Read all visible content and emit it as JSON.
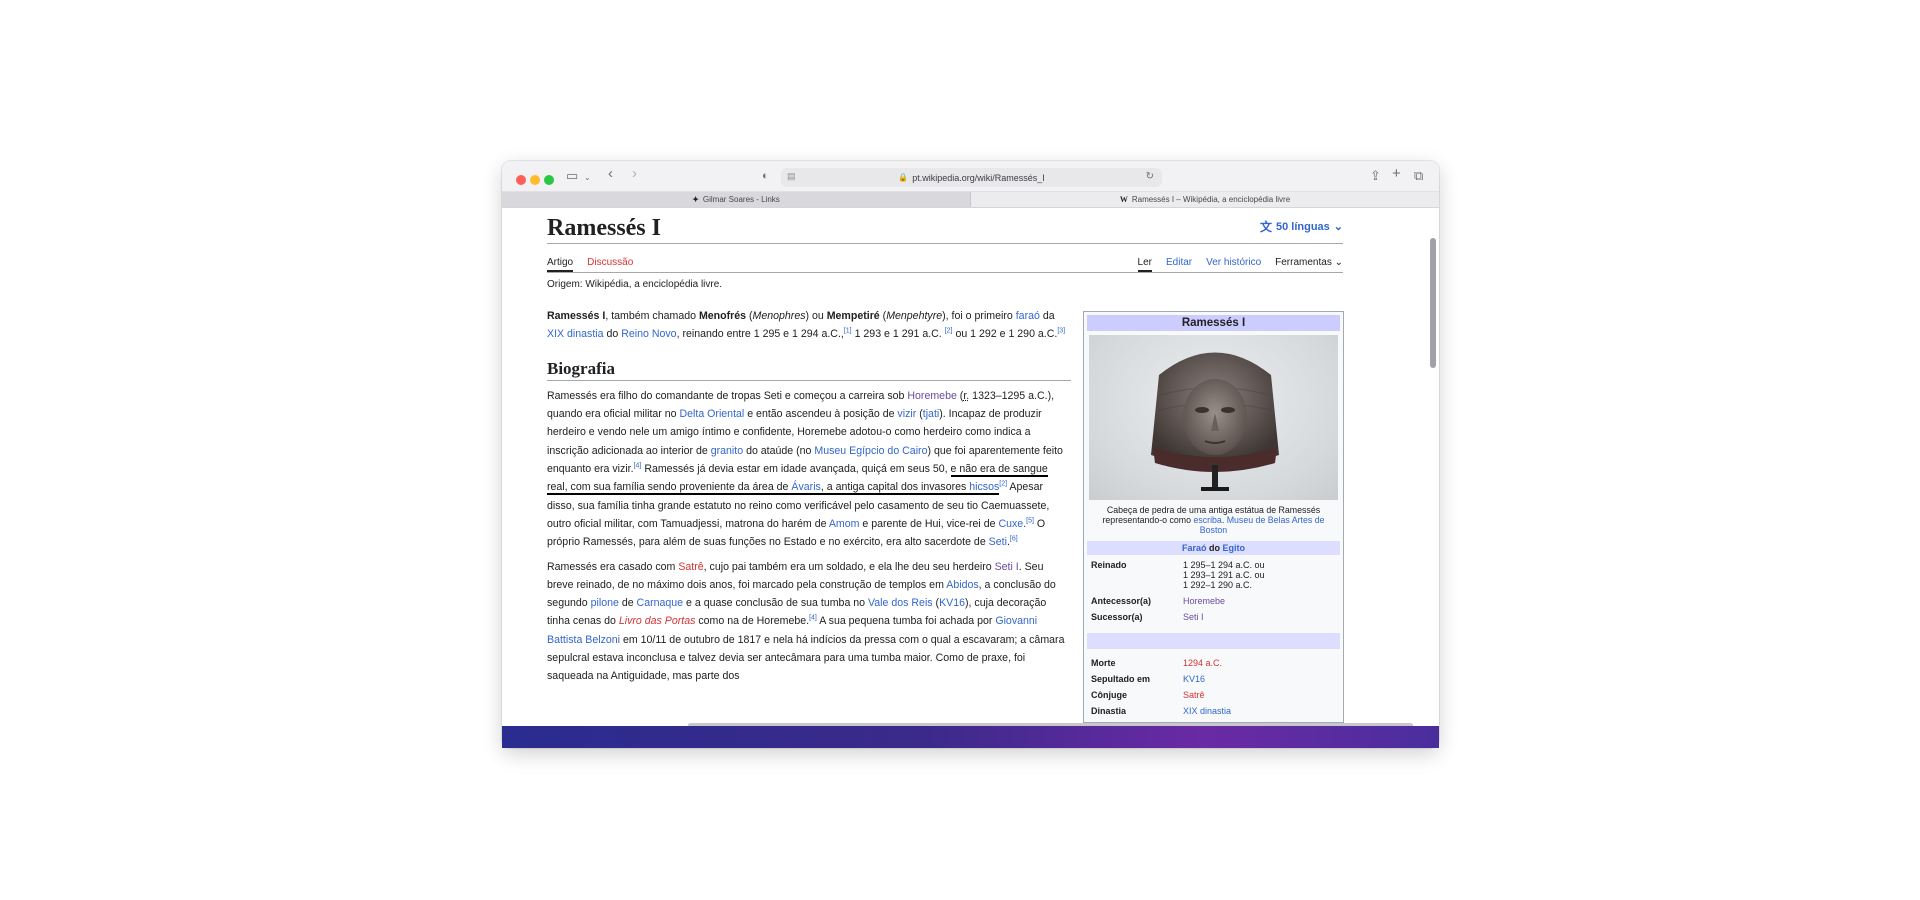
{
  "browser": {
    "url": "pt.wikipedia.org/wiki/Ramessés_I",
    "tabs": [
      {
        "label": "Gilmar Soares - Links"
      },
      {
        "label": "Ramessés I – Wikipédia, a enciclopédia livre"
      }
    ]
  },
  "article": {
    "title": "Ramessés I",
    "languages": "50 línguas",
    "tabs": {
      "article": "Artigo",
      "discussion": "Discussão",
      "read": "Ler",
      "edit": "Editar",
      "history": "Ver histórico",
      "tools": "Ferramentas"
    },
    "origin": "Origem: Wikipédia, a enciclopédia livre.",
    "section": "Biografia",
    "intro": {
      "name": "Ramessés I",
      "t1": ", também chamado ",
      "alt1": "Menofrés",
      "t2": " (",
      "alt1_greek": "Menophres",
      "t3": ") ou ",
      "alt2": "Mempetiré",
      "t4": " (",
      "alt2_orig": "Menpehtyre",
      "t5": "), foi o primeiro ",
      "l_farao": "faraó",
      "t6": " da ",
      "l_dinastia": "XIX dinastia",
      "t7": " do ",
      "l_reino": "Reino Novo",
      "t8": ", reinando entre 1 295 e 1 294 a.C.,",
      "r1": "[1]",
      "t9": " 1 293 e 1 291 a.C. ",
      "r2": "[2]",
      "t10": " ou 1 292 e 1 290 a.C.",
      "r3": "[3]"
    },
    "p1": {
      "a": "Ramessés era filho do comandante de tropas Seti e começou a carreira sob ",
      "l_horemebe": "Horemebe",
      "b": " (",
      "r_abbr": "r.",
      "c": " 1323–1295 a.C.), quando era oficial militar no ",
      "l_delta": "Delta Oriental",
      "d": " e então ascendeu à posição de ",
      "l_vizir": "vizir",
      "e": " (",
      "l_tjati": "tjati",
      "f": "). Incapaz de produzir herdeiro e vendo nele um amigo íntimo e confidente, Horemebe adotou-o como herdeiro como indica a inscrição adicionada ao interior de ",
      "l_granito": "granito",
      "g": " do ataúde (no ",
      "l_museu": "Museu Egípcio do Cairo",
      "h": ") que foi aparentemente feito enquanto era vizir.",
      "r4": "[4]",
      "i": " Ramessés já devia estar em idade avançada, quiçá em seus 50, ",
      "u1": "e não era de sangue real, com sua família sendo proveniente da área de ",
      "l_avaris": "Ávaris",
      "u2": ", a antiga capital dos invasores ",
      "l_hicsos": "hicsos",
      "r2b": "[2]",
      "j": " Apesar disso, sua família tinha grande estatuto no reino como verificável pelo casamento de seu tio Caemuassete, outro oficial militar, com Tamuadjessi, matrona do harém de ",
      "l_amom": "Amom",
      "k": " e parente de Hui, vice-rei de ",
      "l_cuxe": "Cuxe",
      "r5": "[5]",
      "l": " O próprio Ramessés, para além de suas funções no Estado e no exército, era alto sacerdote de ",
      "l_seti": "Seti",
      "m": ".",
      "r6": "[6]"
    },
    "p2": {
      "a": "Ramessés era casado com ",
      "l_satre": "Satrê",
      "b": ", cujo pai também era um soldado, e ela lhe deu seu herdeiro ",
      "l_seti1": "Seti I",
      "c": ". Seu breve reinado, de no máximo dois anos, foi marcado pela construção de templos em ",
      "l_abidos": "Abidos",
      "d": ", a conclusão do segundo ",
      "l_pilone": "pilone",
      "e": " de ",
      "l_carnaque": "Carnaque",
      "f": " e a quase conclusão de sua tumba no ",
      "l_vale": "Vale dos Reis",
      "g": " (",
      "l_kv16": "KV16",
      "h": "), cuja decoração tinha cenas do ",
      "l_livro": "Livro das Portas",
      "i": " como na de Horemebe.",
      "r4": "[4]",
      "j": " A sua pequena tumba foi achada por ",
      "l_belzoni": "Giovanni Battista Belzoni",
      "k": " em 10/11 de outubro de 1817 e nela há indícios da pressa com o qual a escavaram; a câmara sepulcral estava inconclusa e talvez devia ser antecâmara para uma tumba maior. Como de praxe, foi saqueada na Antiguidade, mas parte dos"
    }
  },
  "infobox": {
    "title": "Ramessés I",
    "caption_a": "Cabeça de pedra de uma antiga estátua de Ramessés representando-o como ",
    "caption_l1": "escriba",
    "caption_b": ". ",
    "caption_l2": "Museu de Belas Artes de Boston",
    "sub_l1": "Faraó",
    "sub_mid": " do ",
    "sub_l2": "Egito",
    "rows": [
      {
        "label": "Reinado",
        "value": "1 295–1 294 a.C. ou\n1 293–1 291 a.C. ou\n1 292–1 290 a.C."
      },
      {
        "label": "Antecessor(a)",
        "value": "Horemebe"
      },
      {
        "label": "Sucessor(a)",
        "value": "Seti I"
      },
      {
        "label": "Morte",
        "value": "1294 a.C."
      },
      {
        "label": "Sepultado em",
        "value": "KV16"
      },
      {
        "label": "Cônjuge",
        "value": "Satrê"
      },
      {
        "label": "Dinastia",
        "value": "XIX dinastia"
      }
    ]
  },
  "colors": {
    "link": "#3366cc",
    "redlink": "#d73333",
    "visited": "#6b4ba1",
    "infobox_header": "#ccccff"
  }
}
